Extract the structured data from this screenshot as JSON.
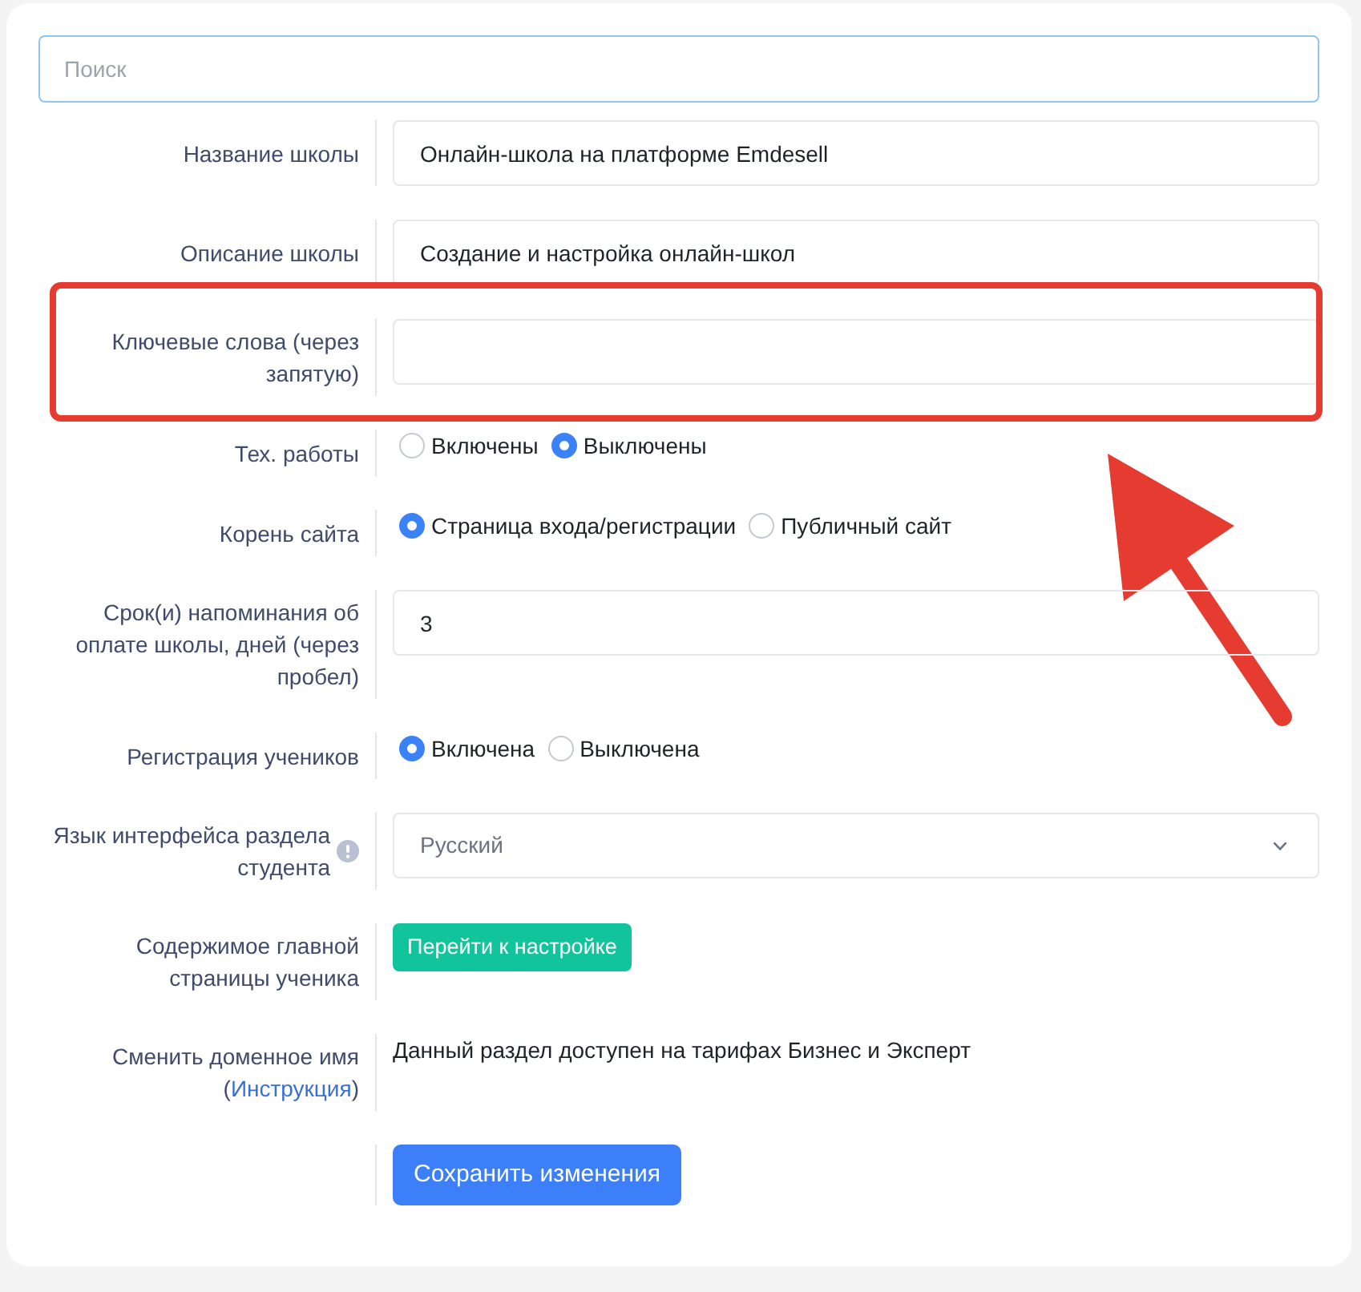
{
  "search": {
    "placeholder": "Поиск"
  },
  "rows": [
    {
      "kind": "text",
      "label": "Название школы",
      "value": "Онлайн-школа на платформе Emdesell",
      "highlighted": false
    },
    {
      "kind": "text",
      "label": "Описание школы",
      "value": "Создание и настройка онлайн-школ",
      "highlighted": false
    },
    {
      "kind": "text",
      "label": "Ключевые слова (через запятую)",
      "highlighted": true
    },
    {
      "kind": "radio",
      "label": "Тех. работы",
      "options": [
        {
          "label": "Включены",
          "selected": false
        },
        {
          "label": "Выключены",
          "selected": true
        }
      ],
      "highlighted": false
    },
    {
      "kind": "radio",
      "label": "Корень сайта",
      "options": [
        {
          "label": "Страница входа/регистрации",
          "selected": true
        },
        {
          "label": "Публичный сайт",
          "selected": false
        }
      ],
      "highlighted": false
    },
    {
      "kind": "text",
      "label": "Срок(и) напоминания об оплате школы, дней (через пробел)",
      "value": "3",
      "highlighted": false
    },
    {
      "kind": "radio",
      "label": "Регистрация учеников",
      "options": [
        {
          "label": "Включена",
          "selected": true
        },
        {
          "label": "Выключена",
          "selected": false
        }
      ],
      "highlighted": false
    },
    {
      "kind": "select",
      "label": "Язык интерфейса раздела студента",
      "info": true,
      "value": "Русский",
      "highlighted": false
    },
    {
      "kind": "button",
      "label": "Содержимое главной страницы ученика",
      "button": "Перейти к настройке",
      "highlighted": false
    },
    {
      "kind": "note",
      "label": "Сменить доменное имя (",
      "link": "Инструкция",
      "label_end": ")",
      "text": "Данный раздел доступен на тарифах Бизнес и Эксперт",
      "highlighted": false
    },
    {
      "kind": "submit",
      "button": "Сохранить изменения",
      "highlighted": false
    }
  ]
}
